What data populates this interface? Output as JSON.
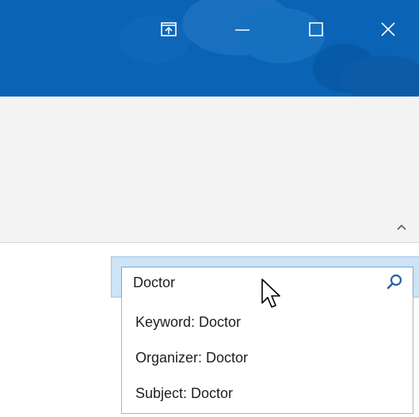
{
  "titlebar": {
    "background": "#0a63b4",
    "buttons": {
      "restore_icon": "window-restore-icon",
      "minimize_icon": "minimize-icon",
      "maximize_icon": "maximize-icon",
      "close_icon": "close-icon"
    }
  },
  "ribbon": {
    "collapse_icon": "chevron-up-icon"
  },
  "search": {
    "value": "Doctor",
    "icon": "search-icon",
    "accent": "#cde3f6"
  },
  "suggestions": [
    {
      "label": "Keyword: Doctor"
    },
    {
      "label": "Organizer: Doctor"
    },
    {
      "label": "Subject: Doctor"
    }
  ],
  "cursor": {
    "icon": "mouse-pointer-icon"
  }
}
